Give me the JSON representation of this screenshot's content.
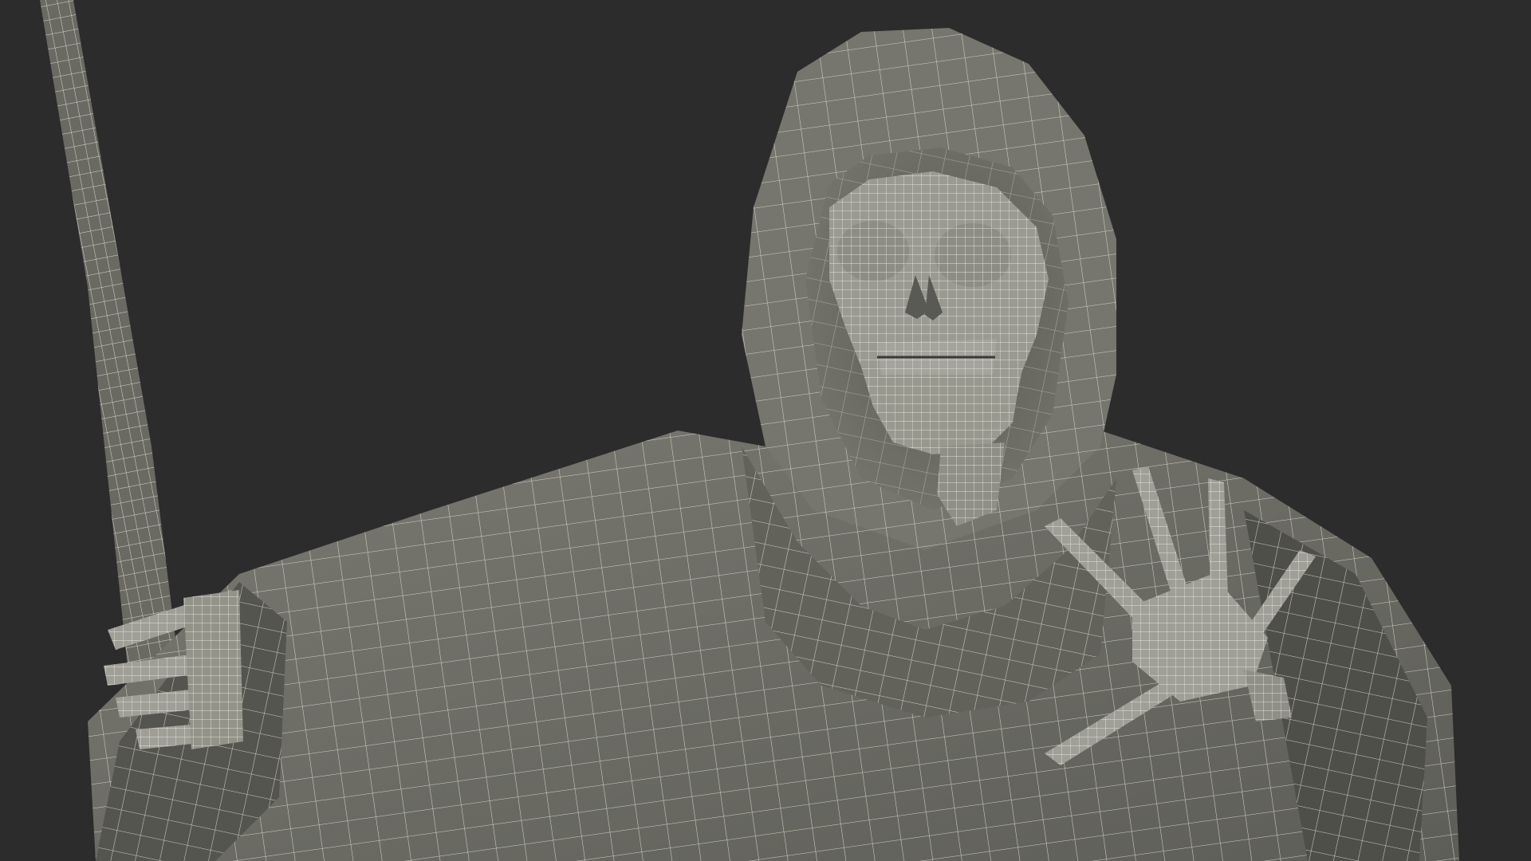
{
  "scene": {
    "subject": "hooded-skeleton-wireframe-render",
    "colors": {
      "background": "#2c2c2c",
      "cloth": "#6d6d66",
      "cloth_shadow": "#55554f",
      "cloth_light": "#84847c",
      "bone": "#9a9a92",
      "wire": "#e6e6dc",
      "cavity": "#3a3a36"
    }
  }
}
